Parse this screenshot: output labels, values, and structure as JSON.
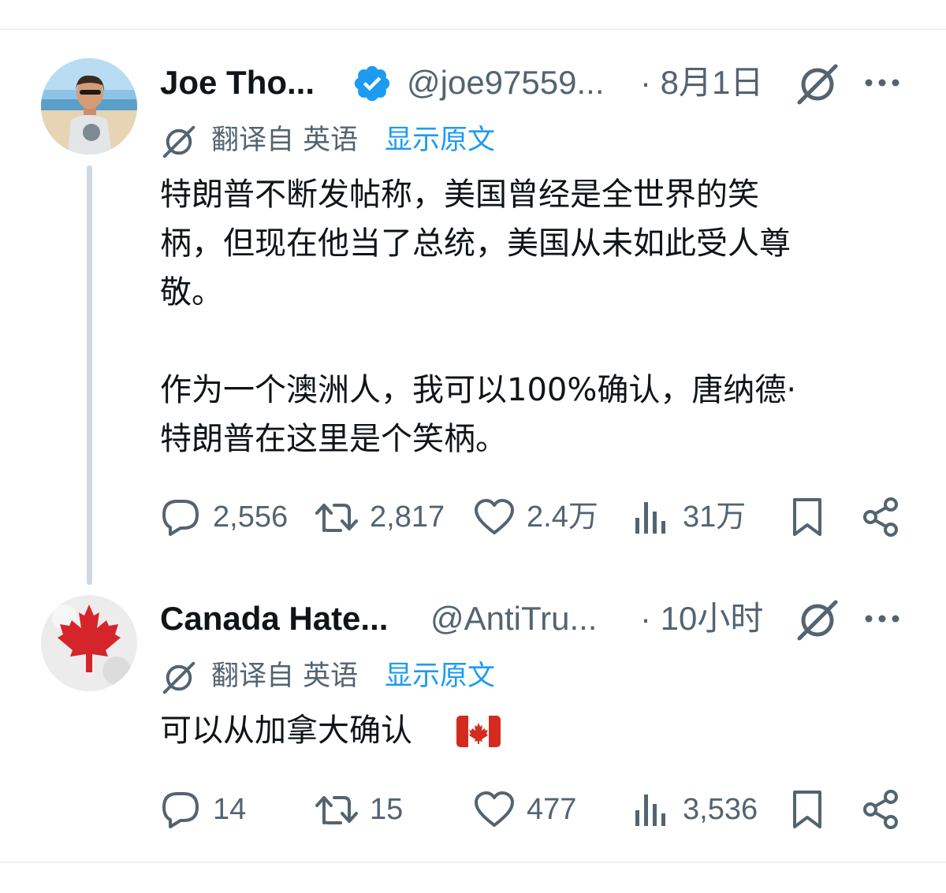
{
  "tweets": [
    {
      "display_name": "Joe Tho...",
      "handle": "@joe97559...",
      "time": "· 8月1日",
      "verified": true,
      "translation": {
        "label": "翻译自 英语",
        "show_original": "显示原文"
      },
      "body_lines": [
        "特朗普不断发帖称，美国曾经是全世界的笑",
        "柄，但现在他当了总统，美国从未如此受人尊",
        "敬。",
        "",
        "作为一个澳洲人，我可以100%确认，唐纳德·",
        "特朗普在这里是个笑柄。"
      ],
      "actions": {
        "replies": "2,556",
        "retweets": "2,817",
        "likes": "2.4万",
        "views": "31万"
      }
    },
    {
      "display_name": "Canada Hate...",
      "handle": "@AntiTru...",
      "time": "· 10小时",
      "verified": false,
      "translation": {
        "label": "翻译自 英语",
        "show_original": "显示原文"
      },
      "body_lines": [
        "可以从加拿大确认"
      ],
      "actions": {
        "replies": "14",
        "retweets": "15",
        "likes": "477",
        "views": "3,536"
      }
    }
  ],
  "colors": {
    "accent": "#1d9bf0",
    "muted": "#536471",
    "text": "#0f1419",
    "thread_line": "#cfd9de"
  },
  "icons": [
    "verified-badge-icon",
    "grok-icon",
    "more-icon",
    "reply-icon",
    "retweet-icon",
    "like-icon",
    "views-icon",
    "bookmark-icon",
    "share-icon",
    "canada-flag-emoji"
  ]
}
